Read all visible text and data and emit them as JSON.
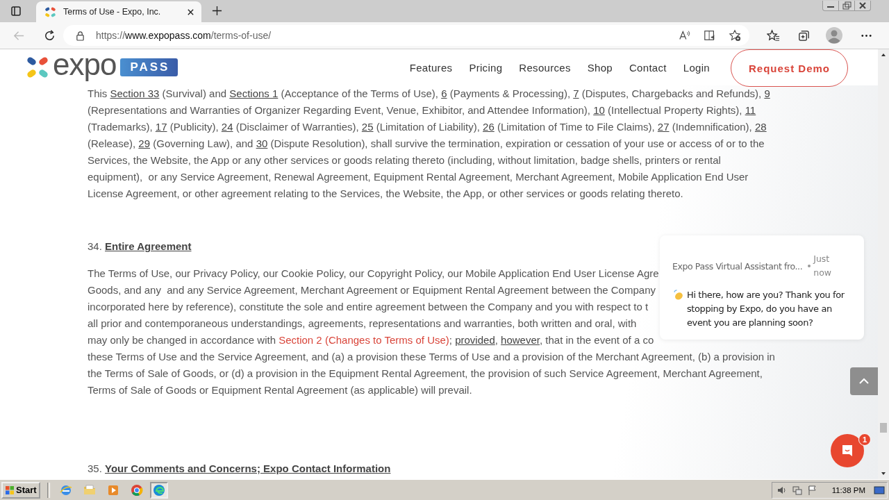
{
  "browser": {
    "tab_title": "Terms of Use - Expo, Inc.",
    "url": {
      "scheme": "https://",
      "host": "www.expopass.com",
      "path": "/terms-of-use/"
    }
  },
  "site_header": {
    "logo_word": "expo",
    "logo_badge": "PASS",
    "nav": [
      "Features",
      "Pricing",
      "Resources",
      "Shop",
      "Contact",
      "Login"
    ],
    "cta": "Request Demo"
  },
  "sections": [
    {
      "lines": [
        [
          {
            "kind": "text",
            "text": "This "
          },
          {
            "kind": "link",
            "text": "Section 33"
          },
          {
            "kind": "text",
            "text": " (Survival) and "
          },
          {
            "kind": "link",
            "text": "Sections 1"
          },
          {
            "kind": "text",
            "text": " (Acceptance of the Terms of Use), "
          },
          {
            "kind": "link",
            "text": "6"
          },
          {
            "kind": "text",
            "text": " (Payments & Processing), "
          },
          {
            "kind": "link",
            "text": "7"
          },
          {
            "kind": "text",
            "text": " (Disputes, Chargebacks and Refunds), "
          },
          {
            "kind": "link",
            "text": "9"
          }
        ],
        [
          {
            "kind": "text",
            "text": "(Representations and Warranties of Organizer Regarding Event, Venue, Exhibitor, and Attendee Information), "
          },
          {
            "kind": "link",
            "text": "10"
          },
          {
            "kind": "text",
            "text": " (Intellectual Property Rights), "
          },
          {
            "kind": "link",
            "text": "11"
          }
        ],
        [
          {
            "kind": "text",
            "text": "(Trademarks), "
          },
          {
            "kind": "link",
            "text": "17"
          },
          {
            "kind": "text",
            "text": " (Publicity), "
          },
          {
            "kind": "link",
            "text": "24"
          },
          {
            "kind": "text",
            "text": " (Disclaimer of Warranties), "
          },
          {
            "kind": "link",
            "text": "25"
          },
          {
            "kind": "text",
            "text": " (Limitation of Liability), "
          },
          {
            "kind": "link",
            "text": "26"
          },
          {
            "kind": "text",
            "text": " (Limitation of Time to File Claims), "
          },
          {
            "kind": "link",
            "text": "27"
          },
          {
            "kind": "text",
            "text": " (Indemnification), "
          },
          {
            "kind": "link",
            "text": "28"
          }
        ],
        [
          {
            "kind": "text",
            "text": "(Release), "
          },
          {
            "kind": "link",
            "text": "29"
          },
          {
            "kind": "text",
            "text": " (Governing Law), and "
          },
          {
            "kind": "link",
            "text": "30"
          },
          {
            "kind": "text",
            "text": " (Dispute Resolution), shall survive the termination, expiration or cessation of your use or access of or to the"
          }
        ],
        [
          {
            "kind": "text",
            "text": "Services, the Website, the App or any other services or goods relating thereto (including, without limitation, badge shells, printers or rental"
          }
        ],
        [
          {
            "kind": "text",
            "text": "equipment),  or any Service Agreement, Renewal Agreement, Equipment Rental Agreement, Merchant Agreement, Mobile Application End User"
          }
        ],
        [
          {
            "kind": "text",
            "text": "License Agreement, or other agreement relating to the Services, the Website, the App, or other services or goods relating thereto."
          }
        ]
      ]
    },
    {
      "heading": {
        "number": "34.",
        "title": "Entire Agreement"
      },
      "lines": [
        [
          {
            "kind": "text",
            "text": "The Terms of Use, our Privacy Policy, our Cookie Policy, our Copyright Policy, our Mobile Application End User License Agre"
          }
        ],
        [
          {
            "kind": "text",
            "text": "Goods, and any  and any Service Agreement, Merchant Agreement or Equipment Rental Agreement between the Company"
          }
        ],
        [
          {
            "kind": "text",
            "text": "incorporated here by reference), constitute the sole and entire agreement between the Company and you with respect to t"
          }
        ],
        [
          {
            "kind": "text",
            "text": "all prior and contemporaneous understandings, agreements, representations and warranties, both written and oral, with"
          }
        ],
        [
          {
            "kind": "text",
            "text": "may only be changed in accordance with "
          },
          {
            "kind": "red_link",
            "text": "Section 2 (Changes to Terms of Use)"
          },
          {
            "kind": "text",
            "text": "; "
          },
          {
            "kind": "link",
            "text": "provided"
          },
          {
            "kind": "text",
            "text": ", "
          },
          {
            "kind": "link",
            "text": "however"
          },
          {
            "kind": "text",
            "text": ", that in the event of a co"
          }
        ],
        [
          {
            "kind": "text",
            "text": "these Terms of Use and the Service Agreement, and (a) a provision these Terms of Use and a provision of the Merchant Agreement, (b) a provision in"
          }
        ],
        [
          {
            "kind": "text",
            "text": "the Terms of Sale of Goods, or (d) a provision in the Equipment Rental Agreement, the provision of such Service Agreement, Merchant Agreement,"
          }
        ],
        [
          {
            "kind": "text",
            "text": "Terms of Sale of Goods or Equipment Rental Agreement (as applicable) will prevail."
          }
        ]
      ]
    },
    {
      "heading": {
        "number": "35.",
        "title": "Your Comments and Concerns; Expo Contact Information"
      }
    }
  ],
  "chat": {
    "sender": "Expo Pass Virtual Assistant fro...",
    "time": "Just now",
    "message": "Hi there, how are you? Thank you for stopping by Expo, do you have an event you are planning soon?",
    "unread": "1"
  },
  "taskbar": {
    "start": "Start",
    "clock": "11:38 PM"
  }
}
